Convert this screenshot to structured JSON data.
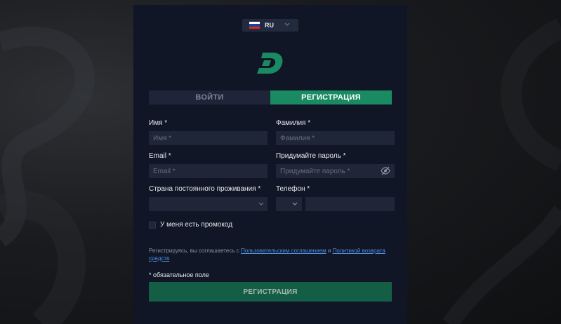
{
  "language": {
    "code": "RU",
    "flag_icon": "russia-flag-icon",
    "chevron_icon": "chevron-down-icon"
  },
  "logo": {
    "icon": "brand-d-logo",
    "color": "#1a8a63"
  },
  "tabs": {
    "login": "ВОЙТИ",
    "register": "РЕГИСТРАЦИЯ",
    "active": "register"
  },
  "form": {
    "first_name": {
      "label": "Имя *",
      "placeholder": "Имя *",
      "value": ""
    },
    "last_name": {
      "label": "Фамилия *",
      "placeholder": "Фамилия *",
      "value": ""
    },
    "email": {
      "label": "Email *",
      "placeholder": "Email *",
      "value": ""
    },
    "password": {
      "label": "Придумайте пароль *",
      "placeholder": "Придумайте пароль *",
      "value": "",
      "toggle_icon": "eye-off-icon"
    },
    "country": {
      "label": "Страна постоянного проживания *",
      "value": ""
    },
    "phone": {
      "label": "Телефон *",
      "code_value": "",
      "value": ""
    },
    "promo": {
      "label": "У меня есть промокод",
      "checked": false
    }
  },
  "terms": {
    "prefix": "Регистрируясь, вы соглашаетесь с",
    "link1": "Пользовательским соглашением",
    "conj": "и",
    "link2": "Политикой возврата средств"
  },
  "required_note": "* обязательное поле",
  "submit_label": "РЕГИСТРАЦИЯ",
  "colors": {
    "accent": "#1a8a63",
    "panel": "#101626",
    "field": "#1f2638",
    "link": "#4d8fe0"
  }
}
